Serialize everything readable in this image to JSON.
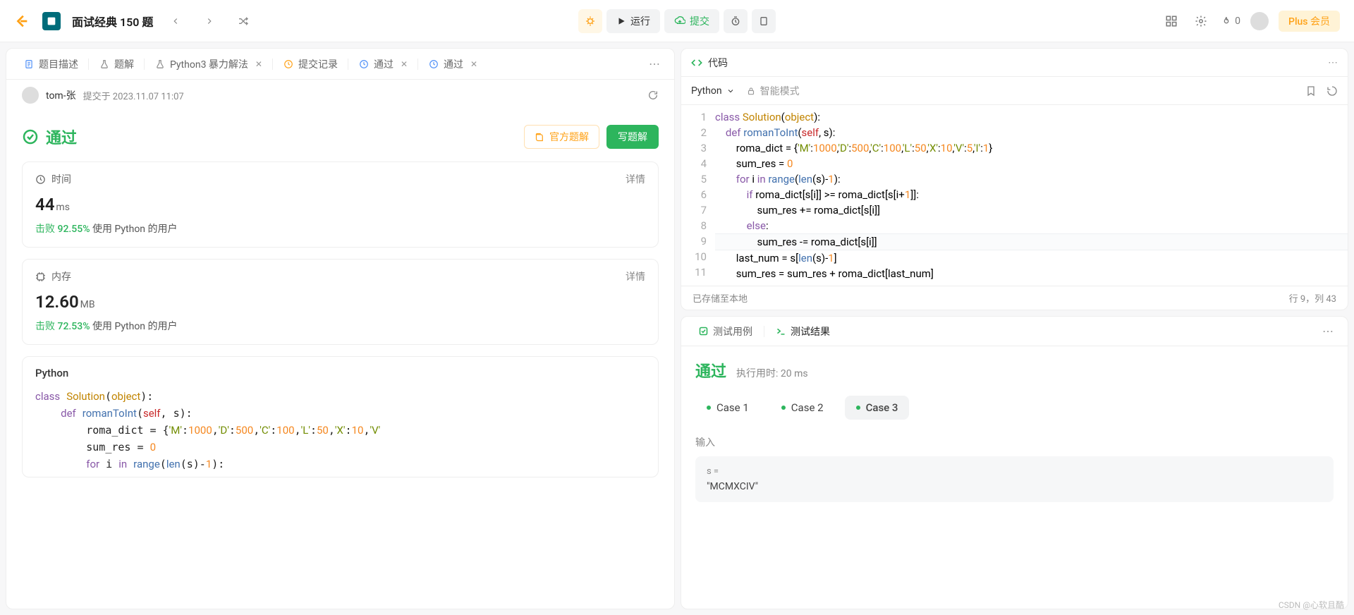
{
  "nav": {
    "title": "面试经典 150 题",
    "run": "运行",
    "submit": "提交",
    "streak": "0",
    "plus": "Plus 会员"
  },
  "leftTabs": {
    "description": "题目描述",
    "solution": "题解",
    "py3brute": "Python3 暴力解法",
    "history": "提交记录",
    "pass1": "通过",
    "pass2": "通过"
  },
  "subHeader": {
    "user": "tom-张",
    "meta": "提交于 2023.11.07 11:07"
  },
  "accept": {
    "status": "通过",
    "officialBtn": "官方题解",
    "writeBtn": "写题解"
  },
  "timeCard": {
    "label": "时间",
    "value": "44",
    "unit": "ms",
    "sub_prefix": "击败",
    "sub_pct": "92.55%",
    "sub_suffix": "使用 Python 的用户",
    "detail": "详情"
  },
  "memCard": {
    "label": "内存",
    "value": "12.60",
    "unit": "MB",
    "sub_prefix": "击败",
    "sub_pct": "72.53%",
    "sub_suffix": "使用 Python 的用户",
    "detail": "详情"
  },
  "codeCard": {
    "lang": "Python"
  },
  "editor": {
    "title": "代码",
    "langSel": "Python",
    "smart": "智能模式",
    "saved": "已存储至本地",
    "pos": "行 9，列 43",
    "lines": {
      "l1": "class Solution(object):",
      "l2": "    def romanToInt(self, s):",
      "l3": "        roma_dict = {'M':1000,'D':500,'C':100,'L':50,'X':10,'V':5,'I':1}",
      "l4": "        sum_res = 0",
      "l5": "        for i in range(len(s)-1):",
      "l6": "            if roma_dict[s[i]] >= roma_dict[s[i+1]]:",
      "l7": "                sum_res += roma_dict[s[i]]",
      "l8": "            else:",
      "l9": "                sum_res -= roma_dict[s[i]]",
      "l10": "        last_num = s[len(s)-1]",
      "l11": "        sum_res = sum_res + roma_dict[last_num]"
    }
  },
  "tests": {
    "tabCases": "测试用例",
    "tabResults": "测试结果",
    "pass": "通过",
    "runtime": "执行用时: 20 ms",
    "case1": "Case 1",
    "case2": "Case 2",
    "case3": "Case 3",
    "inputLabel": "输入",
    "varName": "s =",
    "varVal": "\"MCMXCIV\""
  },
  "watermark": "CSDN @心软且酷"
}
